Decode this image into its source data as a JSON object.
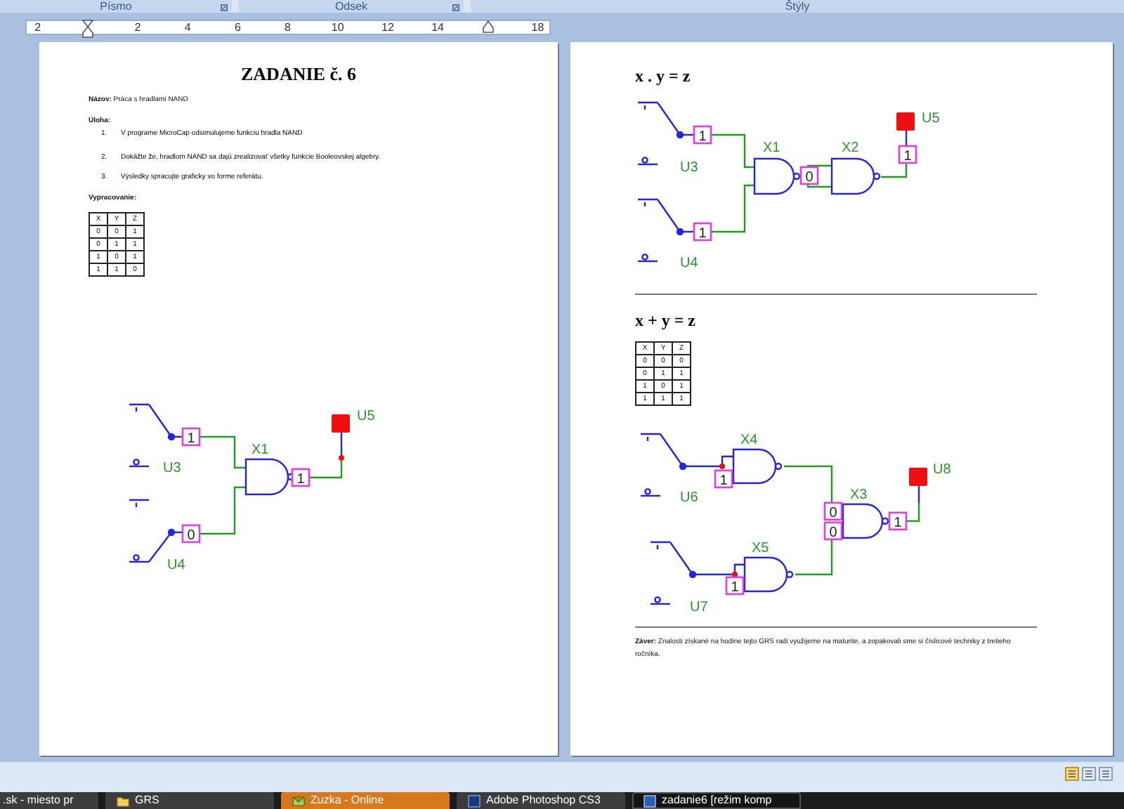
{
  "ribbon_groups": [
    {
      "label": "Písmo"
    },
    {
      "label": "Odsek"
    },
    {
      "label": "Štýly"
    }
  ],
  "ruler": {
    "labels": [
      "2",
      "2",
      "4",
      "6",
      "8",
      "10",
      "12",
      "14",
      "18"
    ]
  },
  "page_1": {
    "title": "ZADANIE č. 6",
    "name_line": "**Názov:** Práca s hradlami NAND",
    "task_heading": "Úloha:",
    "tasks": [
      {
        "number": "1.",
        "text": "V programe MicroCap odsimulujeme funkciu hradla NAND"
      },
      {
        "number": "2.",
        "text": "Dokážte že, hradlom NAND sa dajú zrealizovať všetky funkcie Booleovskej algebry."
      },
      {
        "number": "3.",
        "text": "Výsledky spracujte graficky vo forme referátu."
      }
    ],
    "work_heading": "Vypracovanie:",
    "truth_table": {
      "columns": [
        "X",
        "Y",
        "Z"
      ],
      "rows": [
        [
          "0",
          "0",
          "1"
        ],
        [
          "0",
          "1",
          "1"
        ],
        [
          "1",
          "0",
          "1"
        ],
        [
          "1",
          "1",
          "0"
        ]
      ]
    },
    "circuit": {
      "kind": "nand",
      "switches": [
        {
          "label": "U3",
          "on": true
        },
        {
          "label": "U4",
          "on": false
        }
      ],
      "gates": [
        {
          "label": "X1"
        }
      ],
      "probes": [
        "1",
        "0",
        "1"
      ],
      "output_label": "U5"
    }
  },
  "page_2": {
    "equation_1": "x . y = z",
    "circuit_1": {
      "kind": "and_from_nand",
      "switches": [
        {
          "label": "U3",
          "on": true
        },
        {
          "label": "U4",
          "on": true
        }
      ],
      "gates": [
        {
          "label": "X1"
        },
        {
          "label": "X2"
        }
      ],
      "probes": [
        "1",
        "1",
        "0",
        "1"
      ],
      "output_label": "U5"
    },
    "equation_2": "x + y = z",
    "truth_table": {
      "columns": [
        "X",
        "Y",
        "Z"
      ],
      "rows": [
        [
          "0",
          "0",
          "0"
        ],
        [
          "0",
          "1",
          "1"
        ],
        [
          "1",
          "0",
          "1"
        ],
        [
          "1",
          "1",
          "1"
        ]
      ]
    },
    "circuit_2": {
      "kind": "or_from_nand",
      "switches": [
        {
          "label": "U6",
          "on": true
        },
        {
          "label": "U7",
          "on": true
        }
      ],
      "gates": [
        {
          "label": "X4"
        },
        {
          "label": "X5"
        },
        {
          "label": "X3"
        }
      ],
      "probes": [
        "1",
        "1",
        "0",
        "0",
        "1"
      ],
      "output_label": "U8"
    },
    "conclusion": "**Záver:** Znalosti získané na hodine tejto GRS radi využijeme na maturite, a zopakovali sme si číslicové techniky z tretieho ročníka."
  },
  "taskbar": [
    {
      "label": ".sk - miesto pr",
      "kind": "window",
      "selected": false,
      "attention": false
    },
    {
      "label": "GRS",
      "kind": "folder",
      "selected": false,
      "attention": false
    },
    {
      "label": "Zuzka - Online",
      "kind": "messenger",
      "selected": false,
      "attention": true
    },
    {
      "label": "Adobe Photoshop CS3",
      "kind": "photoshop",
      "selected": false,
      "attention": false
    },
    {
      "label": "zadanie6 [režim komp",
      "kind": "word",
      "selected": true,
      "attention": false
    }
  ]
}
